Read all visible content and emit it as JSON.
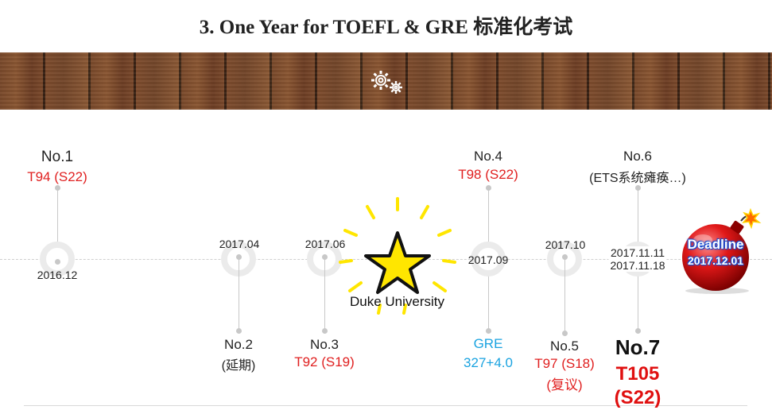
{
  "title": "3. One Year for TOEFL & GRE 标准化考试",
  "milestones": {
    "m1": {
      "label": "No.1",
      "score": "T94 (S22)",
      "date": "2016.12"
    },
    "m2": {
      "label": "No.2",
      "note": "(延期)",
      "date": "2017.04"
    },
    "m3": {
      "label": "No.3",
      "score": "T92 (S19)",
      "date": "2017.06"
    },
    "m4": {
      "label": "No.4",
      "score": "T98 (S22)",
      "date": "2017.09"
    },
    "gre": {
      "label": "GRE",
      "score": "327+4.0"
    },
    "m5": {
      "label": "No.5",
      "score": "T97 (S18)",
      "note": "(复议)",
      "date": "2017.10"
    },
    "m6": {
      "label": "No.6",
      "note": "(ETS系统瘫痪…)",
      "date": "2017.11.11"
    },
    "m7": {
      "label": "No.7",
      "score_line1": "T105",
      "score_line2": "(S22)",
      "date": "2017.11.18"
    }
  },
  "duke": "Duke University",
  "deadline": {
    "label": "Deadline",
    "date": "2017.12.01"
  },
  "colors": {
    "red": "#e02020",
    "blue": "#1aa3e0",
    "star": "#ffe600",
    "bomb": "#d01010"
  },
  "icons": [
    "gears-icon",
    "star-icon",
    "bomb-icon"
  ]
}
